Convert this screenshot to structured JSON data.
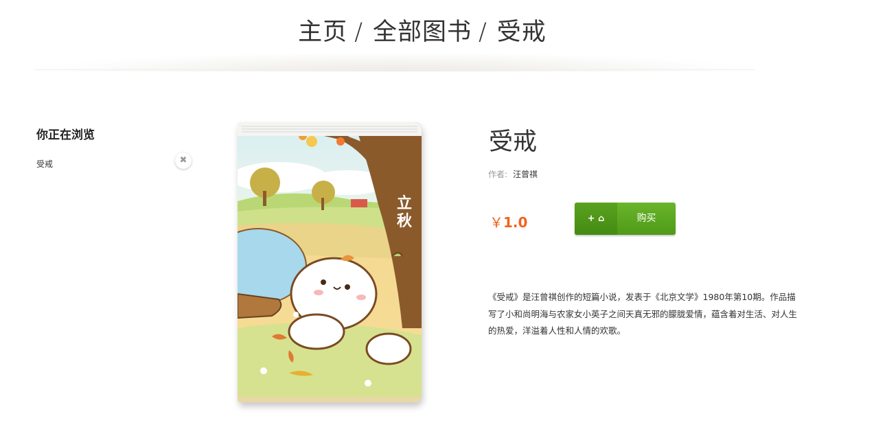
{
  "breadcrumb": {
    "home": "主页",
    "all_books": "全部图书",
    "current": "受戒",
    "separator": "/"
  },
  "sidebar": {
    "title": "你正在浏览",
    "items": [
      {
        "label": "受戒",
        "remove_icon": "close-icon"
      }
    ]
  },
  "book": {
    "title": "受戒",
    "author_label": "作者:",
    "author": "汪曾祺",
    "cover_text": "立秋",
    "price_symbol": "￥",
    "price": "1.0",
    "buy_icon_text": "+ ⌂",
    "buy_label": "购买",
    "description": "《受戒》是汪曾祺创作的短篇小说，发表于《北京文学》1980年第10期。作品描写了小和尚明海与农家女小英子之间天真无邪的朦胧爱情，蕴含着对生活、对人生的热爱，洋溢着人性和人情的欢歌。"
  },
  "colors": {
    "accent_price": "#f0641e",
    "button_green": "#5aa21f"
  }
}
